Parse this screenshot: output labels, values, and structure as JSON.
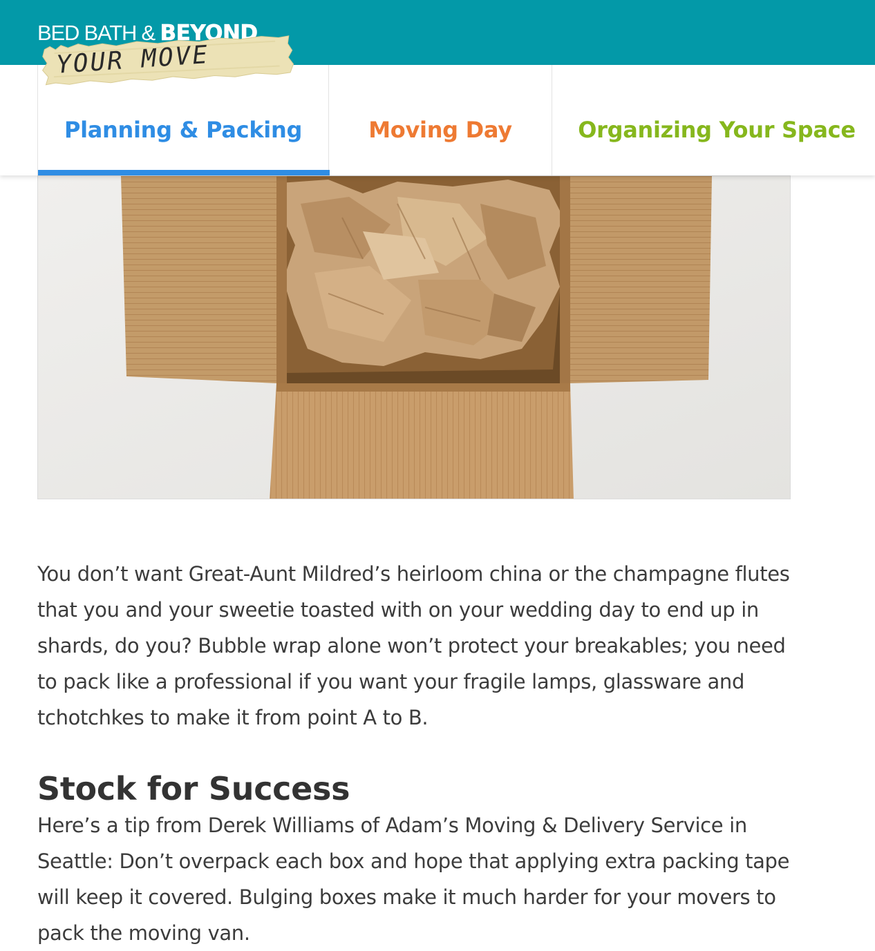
{
  "header": {
    "brand_part1": "BED BATH & ",
    "brand_part2": "BEYOND",
    "tagline": "YOUR MOVE",
    "bg_color": "#0399a8"
  },
  "tabs": [
    {
      "label": "Planning & Packing",
      "color": "#2f8de4",
      "active": true
    },
    {
      "label": "Moving Day",
      "color": "#ee7a33",
      "active": false
    },
    {
      "label": "Organizing Your Space",
      "color": "#86b71d",
      "active": false
    }
  ],
  "hero": {
    "image_name": "open-cardboard-box-with-packing-paper"
  },
  "article": {
    "intro": "You don’t want Great-Aunt Mildred’s heirloom china or the champagne flutes that you and your sweetie toasted with on your wedding day to end up in shards, do you? Bubble wrap alone won’t protect your breakables; you need to pack like a professional if you want your fragile lamps, glassware and tchotchkes to make it from point A to B.",
    "section_heading": "Stock for Success",
    "section_body": "Here’s a tip from Derek Williams of Adam’s Moving & Delivery Service in Seattle: Don’t overpack each box and hope that applying extra packing tape will keep it covered. Bulging boxes make it much harder for your movers to pack the moving van."
  }
}
